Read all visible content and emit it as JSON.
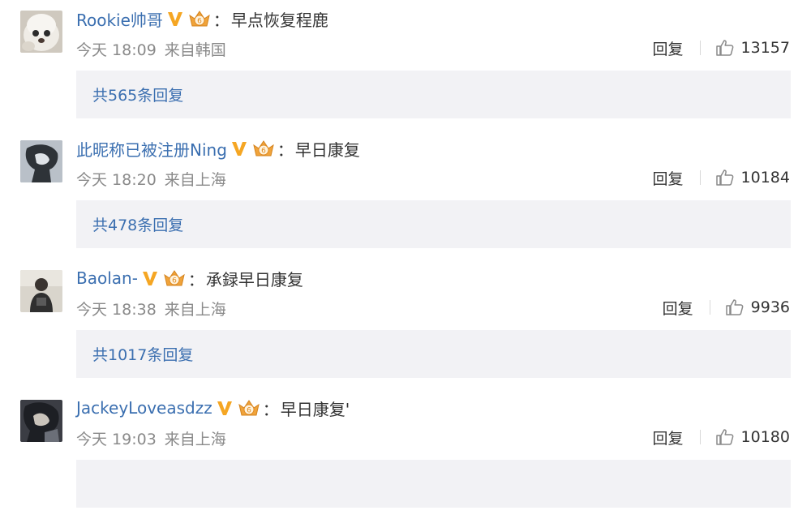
{
  "comments": [
    {
      "username": "Rookie帅哥",
      "text": "早点恢复程鹿",
      "time": "今天 18:09",
      "location": "来自韩国",
      "reply_label": "回复",
      "likes": "13157",
      "replies_text": "共565条回复"
    },
    {
      "username": "此昵称已被注册Ning",
      "text": "早日康复",
      "time": "今天 18:20",
      "location": "来自上海",
      "reply_label": "回复",
      "likes": "10184",
      "replies_text": "共478条回复"
    },
    {
      "username": "Baolan-",
      "text": "承録早日康复",
      "time": "今天 18:38",
      "location": "来自上海",
      "reply_label": "回复",
      "likes": "9936",
      "replies_text": "共1017条回复"
    },
    {
      "username": "JackeyLoveasdzz",
      "text": "早日康复'",
      "time": "今天 19:03",
      "location": "来自上海",
      "reply_label": "回复",
      "likes": "10180",
      "replies_text": ""
    }
  ],
  "colon": "：",
  "icons": {
    "vip": "vip-v-icon",
    "member": "crown-badge-icon",
    "like": "thumbs-up-icon"
  },
  "colors": {
    "username": "#3b6fb0",
    "vip_v": "#f5a623",
    "meta": "#8a8a8a",
    "reply_box": "#f2f2f5"
  }
}
